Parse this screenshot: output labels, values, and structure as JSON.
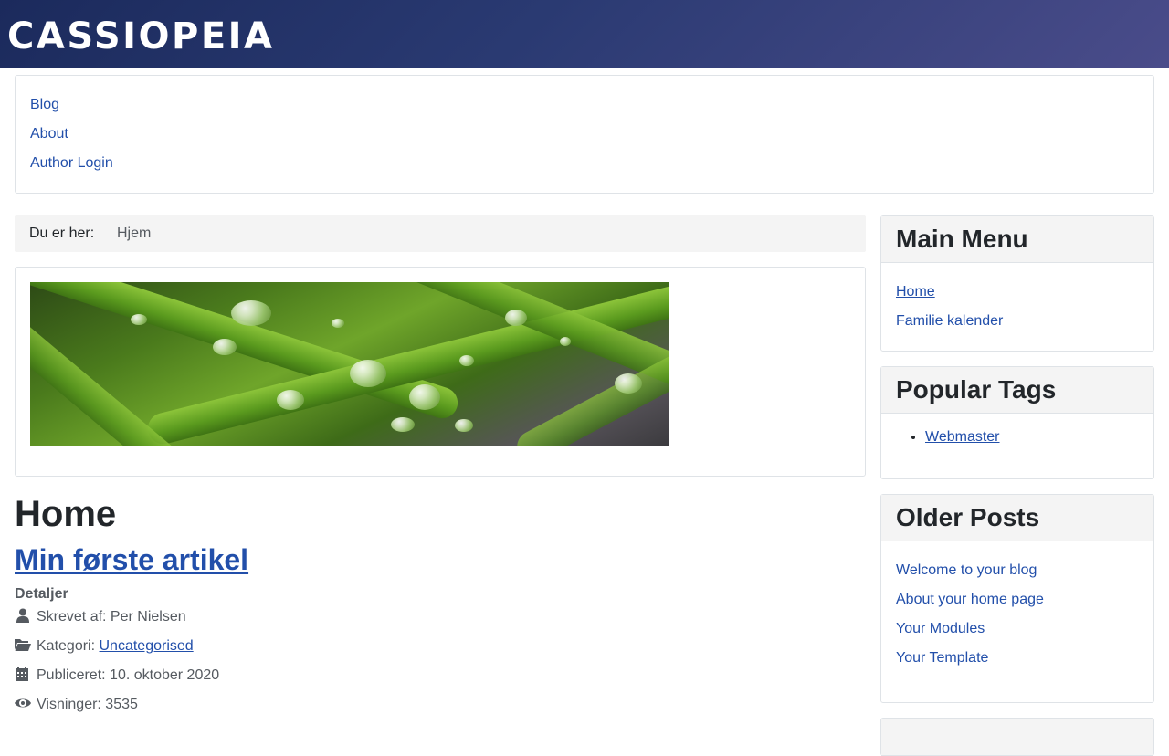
{
  "site": {
    "brand": "CASSIOPEIA"
  },
  "topnav": {
    "items": [
      "Blog",
      "About",
      "Author Login"
    ]
  },
  "breadcrumb": {
    "label": "Du er her:",
    "current": "Hjem"
  },
  "hero": {
    "alt_icon": "grass-waterdrops-image"
  },
  "content": {
    "page_title": "Home",
    "article_title": "Min første artikel",
    "details_heading": "Detaljer",
    "author": "Skrevet af: Per Nielsen",
    "category_label": "Kategori:",
    "category_link": "Uncategorised",
    "published": "Publiceret: 10. oktober 2020",
    "views": "Visninger: 3535"
  },
  "sidebar": {
    "main_menu": {
      "title": "Main Menu",
      "items": [
        "Home",
        "Familie kalender"
      ]
    },
    "popular_tags": {
      "title": "Popular Tags",
      "items": [
        "Webmaster"
      ]
    },
    "older_posts": {
      "title": "Older Posts",
      "items": [
        "Welcome to your blog",
        "About your home page",
        "Your Modules",
        "Your Template"
      ]
    }
  },
  "colors": {
    "link": "#224faa",
    "header_start": "#1b2a5c",
    "header_end": "#4a4c8a"
  }
}
